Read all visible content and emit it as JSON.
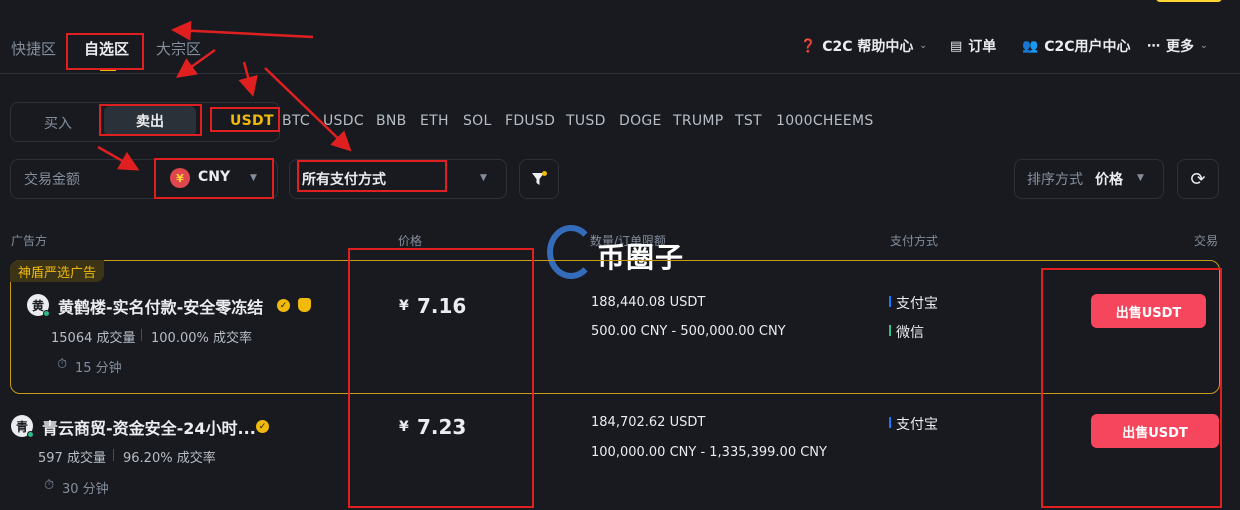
{
  "top_tabs": {
    "quick": "快捷区",
    "watchlist": "自选区",
    "bulk": "大宗区"
  },
  "nav_right": {
    "help_center": "C2C 帮助中心",
    "orders": "订单",
    "user_center": "C2C用户中心",
    "more": "更多"
  },
  "trade_side": {
    "buy": "买入",
    "sell": "卖出"
  },
  "coins": [
    "USDT",
    "BTC",
    "USDC",
    "BNB",
    "ETH",
    "SOL",
    "FDUSD",
    "TUSD",
    "DOGE",
    "TRUMP",
    "TST",
    "1000CHEEMS"
  ],
  "filters": {
    "amount_label": "交易金额",
    "currency_symbol": "¥",
    "currency": "CNY",
    "payment": "所有支付方式",
    "sort_label": "排序方式",
    "sort_value": "价格"
  },
  "table_headers": {
    "advertiser": "广告方",
    "price": "价格",
    "limit": "数量/订单限额",
    "payment": "支付方式",
    "trade": "交易"
  },
  "watermark": "币圈子",
  "ads": [
    {
      "tag": "神盾严选广告",
      "avatar": "黄",
      "name": "黄鹤楼-实名付款-安全零冻结",
      "trades": "15064 成交量",
      "completion": "100.00% 成交率",
      "time": "15 分钟",
      "currency_sign": "¥",
      "price": "7.16",
      "amount": "188,440.08 USDT",
      "limit": "500.00 CNY - 500,000.00 CNY",
      "payments": [
        "支付宝",
        "微信"
      ],
      "button": "出售USDT"
    },
    {
      "avatar": "青",
      "name": "青云商贸-资金安全-24小时...",
      "trades": "597 成交量",
      "completion": "96.20% 成交率",
      "time": "30 分钟",
      "currency_sign": "¥",
      "price": "7.23",
      "amount": "184,702.62 USDT",
      "limit": "100,000.00 CNY - 1,335,399.00 CNY",
      "payments": [
        "支付宝"
      ],
      "button": "出售USDT"
    }
  ],
  "colors": {
    "background": "#181a20",
    "accent": "#f0b90b",
    "sell": "#f6465d",
    "annotation": "#e02020",
    "alipay": "#1677ff",
    "wechat": "#2ebd85"
  }
}
